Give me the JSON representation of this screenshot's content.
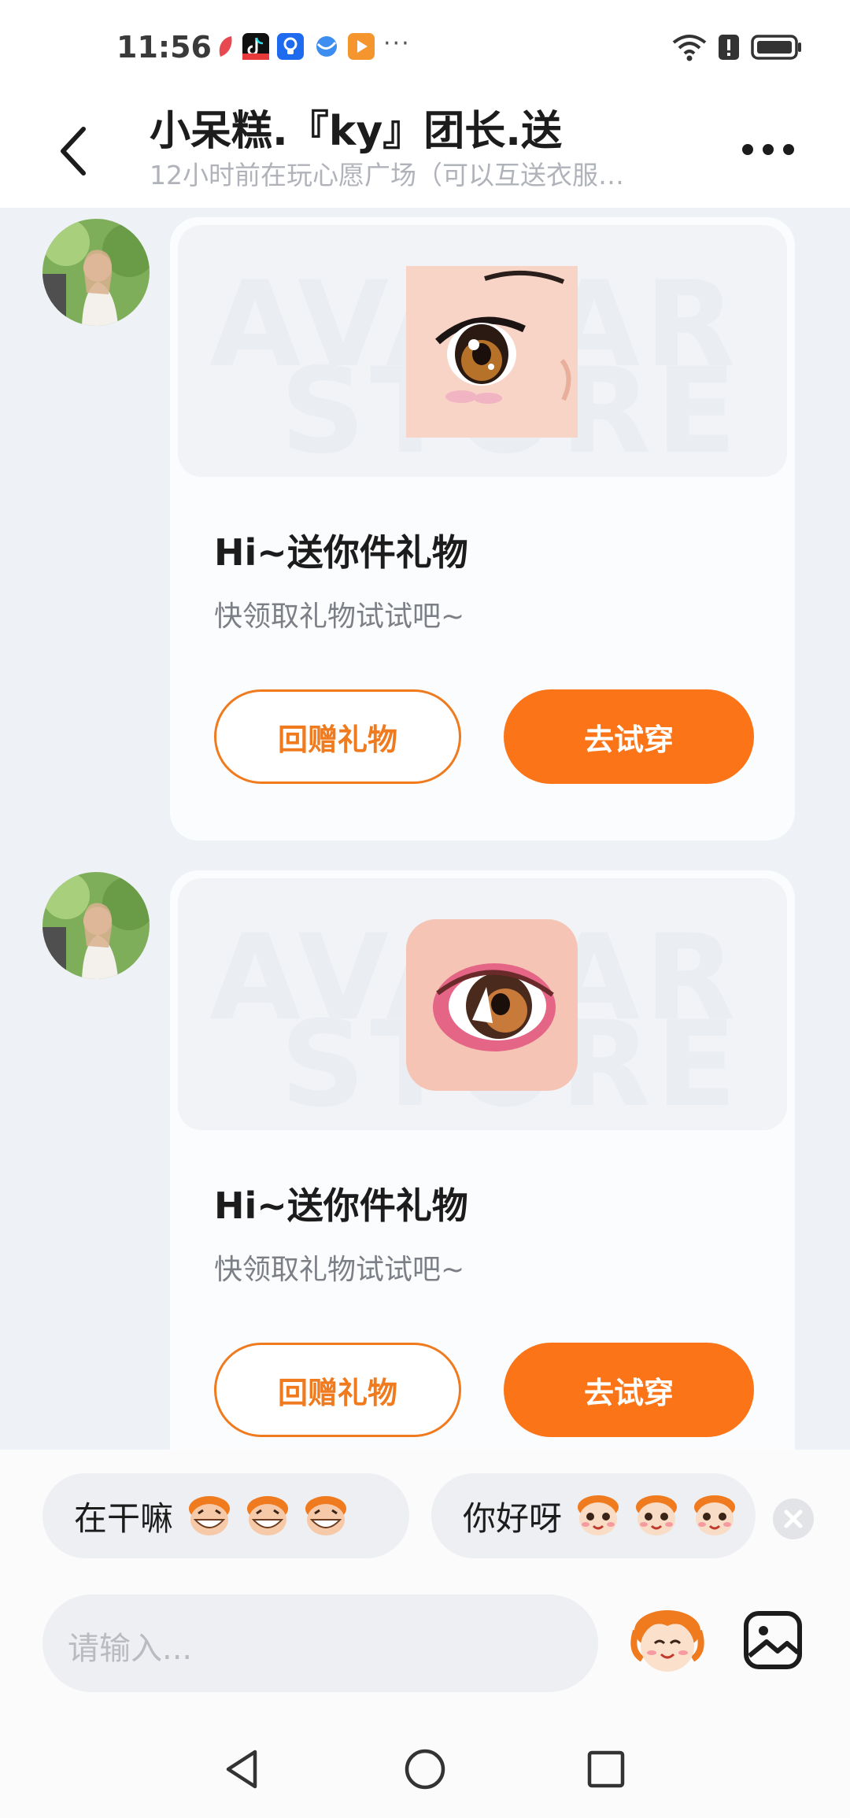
{
  "status_bar": {
    "time": "11:56",
    "app_icons": [
      "red-leaf-app-icon",
      "tiktok-icon",
      "lightbulb-app-icon",
      "browser-icon",
      "video-play-app-icon"
    ],
    "overflow": "···",
    "right_icons": [
      "wifi-icon",
      "alert-icon",
      "battery-icon"
    ]
  },
  "header": {
    "title": "小呆糕.『ky』团长.送",
    "subtitle": "12小时前在玩心愿广场（可以互送衣服…"
  },
  "messages": [
    {
      "watermark_line1": "AVATAR",
      "watermark_line2": "STORE",
      "title": "Hi~送你件礼物",
      "desc": "快领取礼物试试吧~",
      "btn_return": "回赠礼物",
      "btn_try": "去试穿"
    },
    {
      "watermark_line1": "AVATAR",
      "watermark_line2": "STORE",
      "title": "Hi~送你件礼物",
      "desc": "快领取礼物试试吧~",
      "btn_return": "回赠礼物",
      "btn_try": "去试穿"
    }
  ],
  "quick_replies": [
    {
      "text": "在干嘛"
    },
    {
      "text": "你好呀"
    }
  ],
  "composer": {
    "placeholder": "请输入..."
  },
  "colors": {
    "accent": "#fb7518",
    "background": "#eef1f6",
    "card": "#fbfcfd"
  }
}
